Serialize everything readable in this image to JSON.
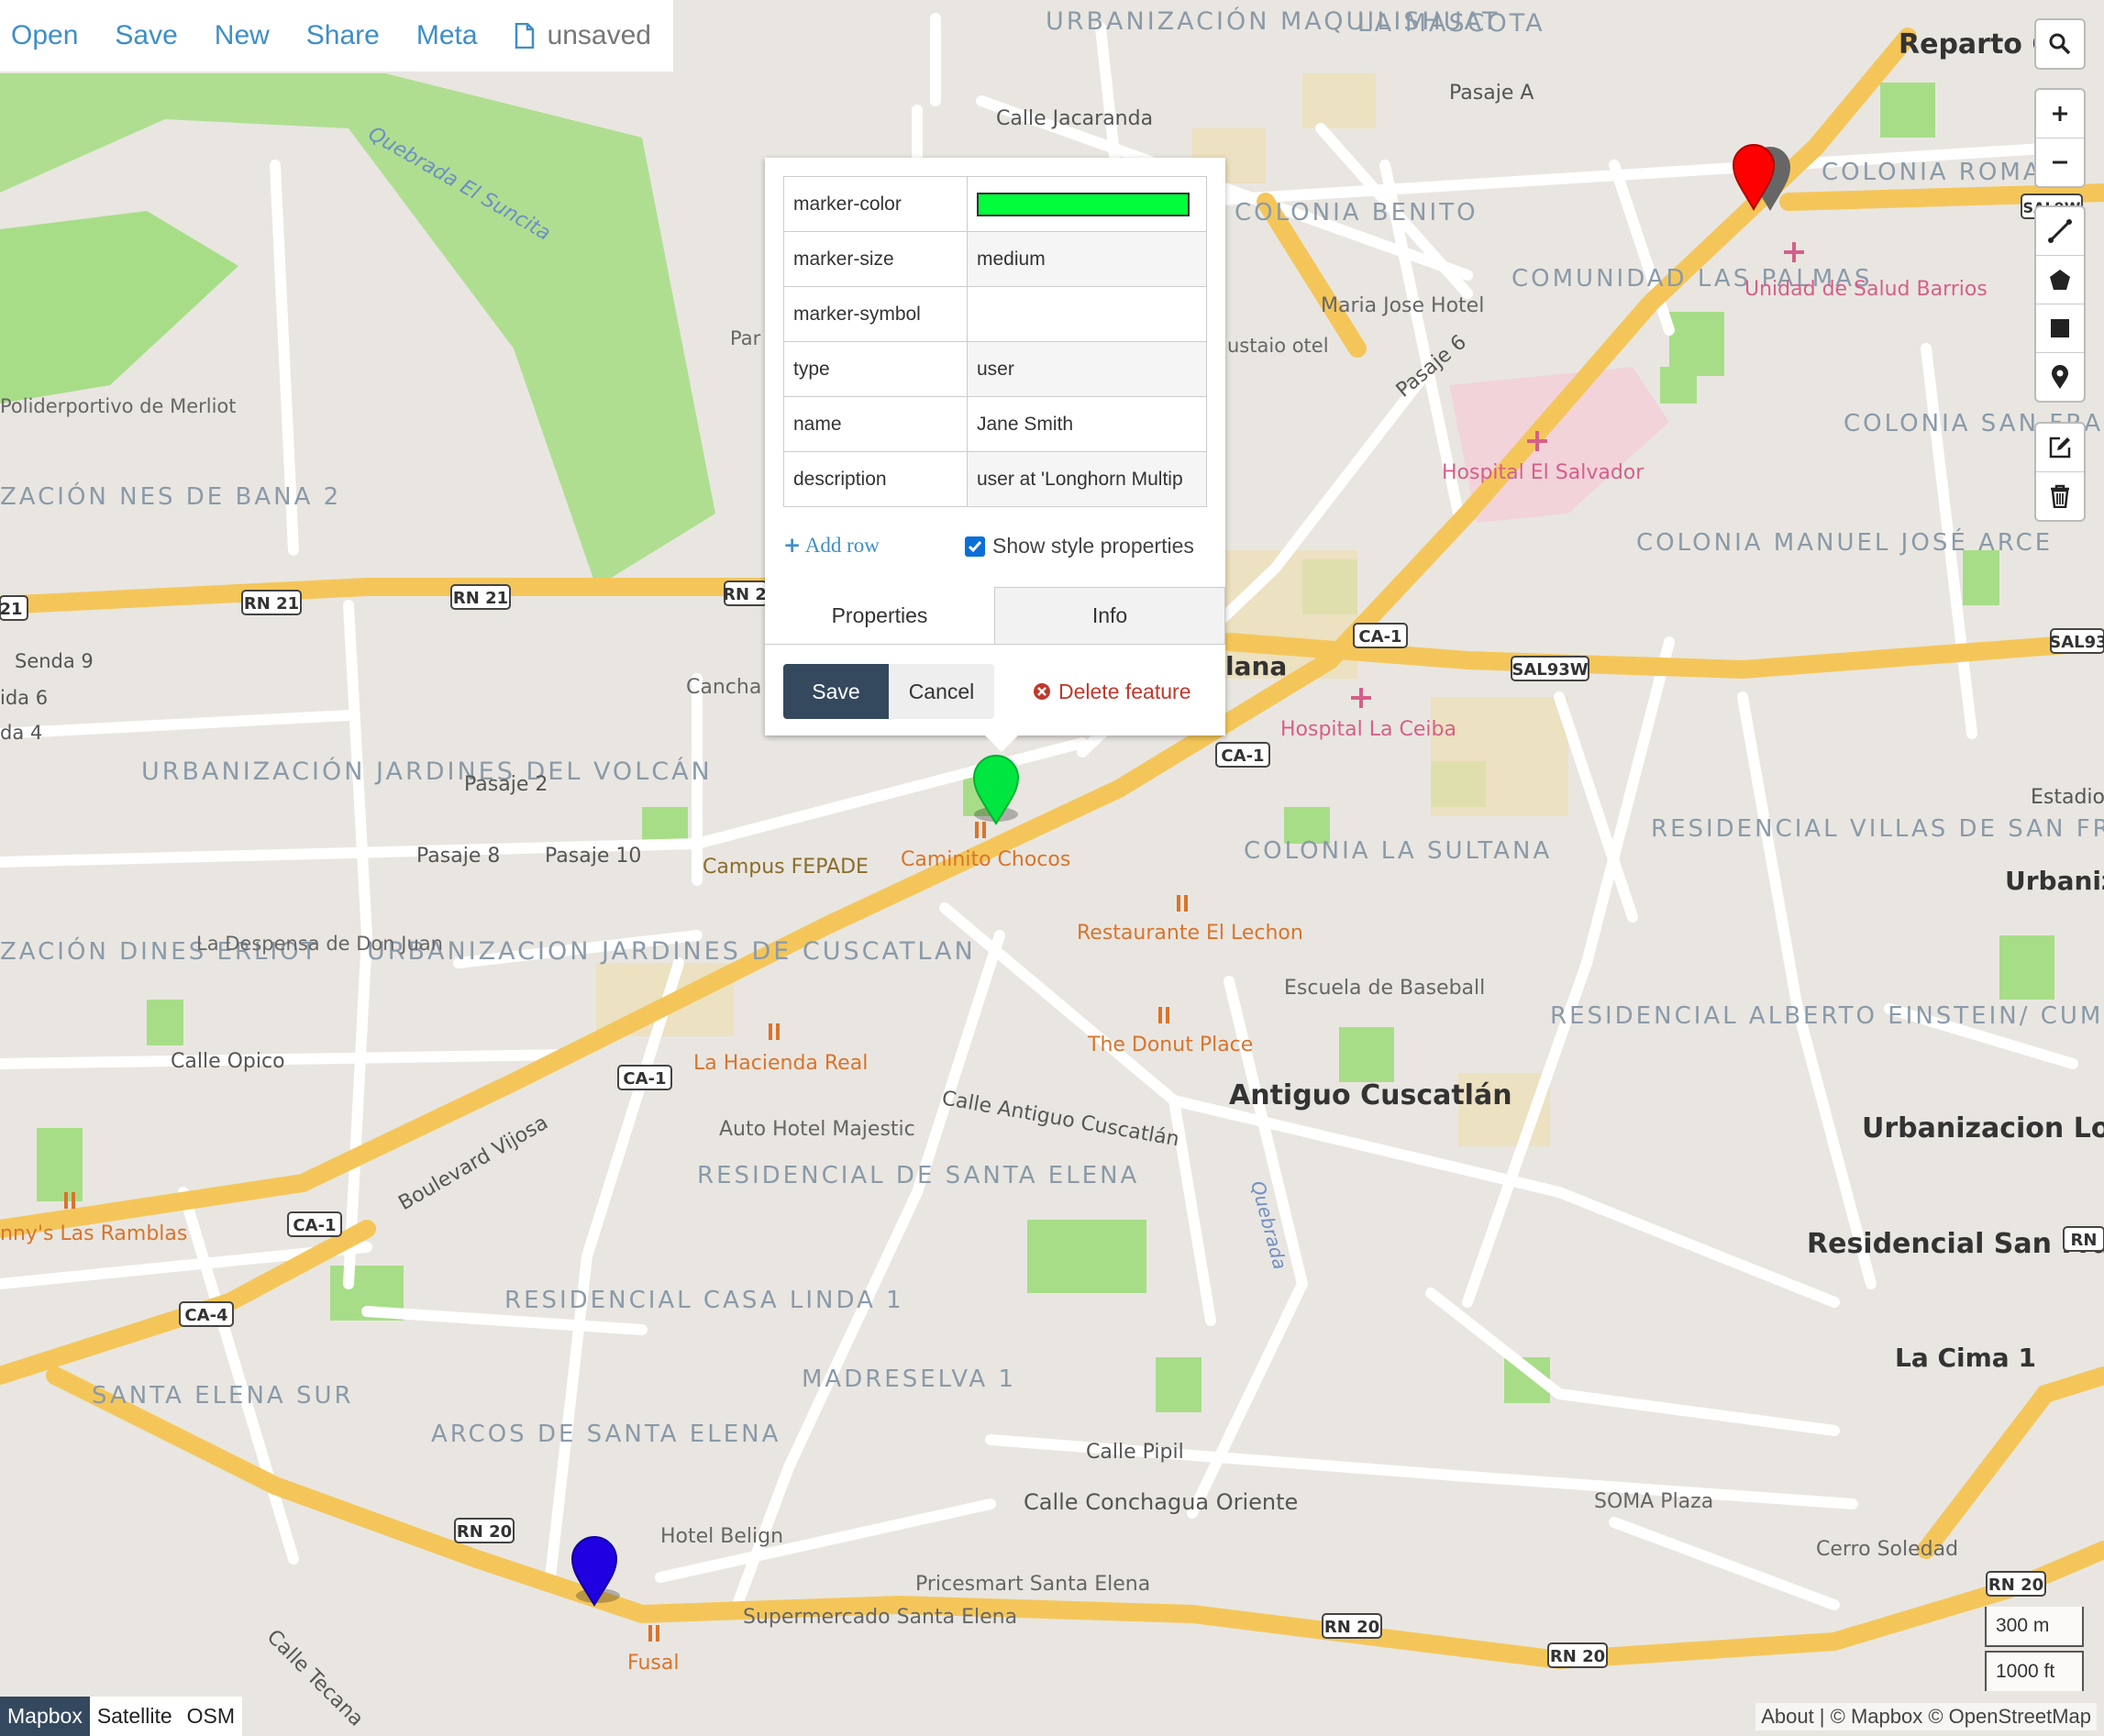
{
  "topbar": {
    "menu": [
      "Open",
      "Save",
      "New",
      "Share",
      "Meta"
    ],
    "file_status": "unsaved"
  },
  "map": {
    "areas": [
      "URBANIZACIÓN MAQUILISHUAT",
      "LA MASCOTA",
      "Reparto Ca",
      "COLONIA ROMA",
      "COLONIA BENITO",
      "COMUNIDAD LAS PALMAS",
      "COLONIA SAN FRANCISCO",
      "COLONIA MANUEL JOSÉ ARCE",
      "URBANIZACIÓN JARDINES DEL VOLCÁN",
      "URBANIZACION JARDINES DE CUSCATLAN",
      "COLONIA LA SULTANA",
      "RESIDENCIAL VILLAS DE SAN FRANCISCO",
      "RESIDENCIAL ALBERTO EINSTEIN/ CUMBRES DE SAN FRANCISCO",
      "RESIDENCIAL DE SANTA ELENA",
      "RESIDENCIAL CASA LINDA 1",
      "MADRESELVA 1",
      "ARCOS DE SANTA ELENA",
      "SANTA ELENA SUR",
      "ZACIÓN NES DE BANA 2",
      "ZACIÓN DINES ERLIOT"
    ],
    "towns": [
      "Antiguo Cuscatlán",
      "Urbanizacion Lomas de San Francisco",
      "Residencial San Francisco I",
      "La Cima 1",
      "Urbaniz Loma L",
      "Estadio",
      "lana"
    ],
    "streets": [
      "Calle Jacaranda",
      "Pasaje A",
      "Pasaje 6",
      "Quebrada El Suncita",
      "Senda 9",
      "ida 6",
      "da 4",
      "Pasaje 2",
      "Pasaje 8",
      "Pasaje 10",
      "Calle Opico",
      "Boulevard Vijosa",
      "Calle Antiguo Cuscatlán",
      "Quebrada",
      "Calle Pipil",
      "Calle Conchagua Oriente",
      "Calle Tecana"
    ],
    "road_shields": [
      "RN 21",
      "RN 21",
      "RN 2",
      "21",
      "CA-1",
      "SAL93W",
      "SAL93",
      "CA-1",
      "CA-1",
      "CA-1",
      "CA-4",
      "RN 20",
      "RN 20",
      "RN 20",
      "RN 20",
      "RN",
      "SAL9W"
    ],
    "pois_orange": [
      "Caminito Chocos",
      "Restaurante El Lechon",
      "The Donut Place",
      "La Hacienda Real",
      "nny's Las Ramblas",
      "Fusal"
    ],
    "pois_gray": [
      "Maria Jose Hotel",
      "Campus FEPADE",
      "Cancha d Escuela M",
      "La Despensa de Don Juan",
      "Escuela de Baseball",
      "Auto Hotel Majestic",
      "Hotel Belign",
      "Supermercado Santa Elena",
      "Pricesmart Santa Elena",
      "SOMA Plaza",
      "Cerro Soledad",
      "Poliderportivo de Merliot",
      "Par L",
      "ustaio otel"
    ],
    "pois_pink": [
      "Unidad de Salud Barrios",
      "Hospital El Salvador",
      "Hospital La Ceiba"
    ],
    "colors": {
      "road": "#f4c65a",
      "park": "#a8dd88",
      "water_label": "#6d8fc4",
      "poi_orange": "#d9742b",
      "poi_pink": "#d45f8a"
    }
  },
  "markers": [
    {
      "name": "green-marker",
      "color": "#00e640"
    },
    {
      "name": "red-marker",
      "color": "#ff0000"
    },
    {
      "name": "blue-marker",
      "color": "#2000e0"
    }
  ],
  "popup": {
    "rows": [
      {
        "key": "marker-color",
        "value": "",
        "swatch": "#00ff3a"
      },
      {
        "key": "marker-size",
        "value": "medium"
      },
      {
        "key": "marker-symbol",
        "value": ""
      },
      {
        "key": "type",
        "value": "user"
      },
      {
        "key": "name",
        "value": "Jane Smith"
      },
      {
        "key": "description",
        "value": "user at 'Longhorn Multip"
      }
    ],
    "add_row": "Add row",
    "show_style": "Show style properties",
    "show_style_checked": true,
    "tabs": [
      "Properties",
      "Info"
    ],
    "save": "Save",
    "cancel": "Cancel",
    "delete": "Delete feature"
  },
  "controls": {
    "icons": [
      "search-icon",
      "zoom-in-icon",
      "zoom-out-icon",
      "draw-line-icon",
      "draw-polygon-icon",
      "draw-rectangle-icon",
      "draw-marker-icon",
      "edit-icon",
      "trash-icon"
    ]
  },
  "layers": {
    "options": [
      "Mapbox",
      "Satellite",
      "OSM"
    ],
    "selected": "Mapbox"
  },
  "scale": {
    "metric": "300 m",
    "imperial": "1000 ft"
  },
  "attribution": {
    "about": "About",
    "mapbox": "© Mapbox",
    "osm": "© OpenStreetMap"
  }
}
